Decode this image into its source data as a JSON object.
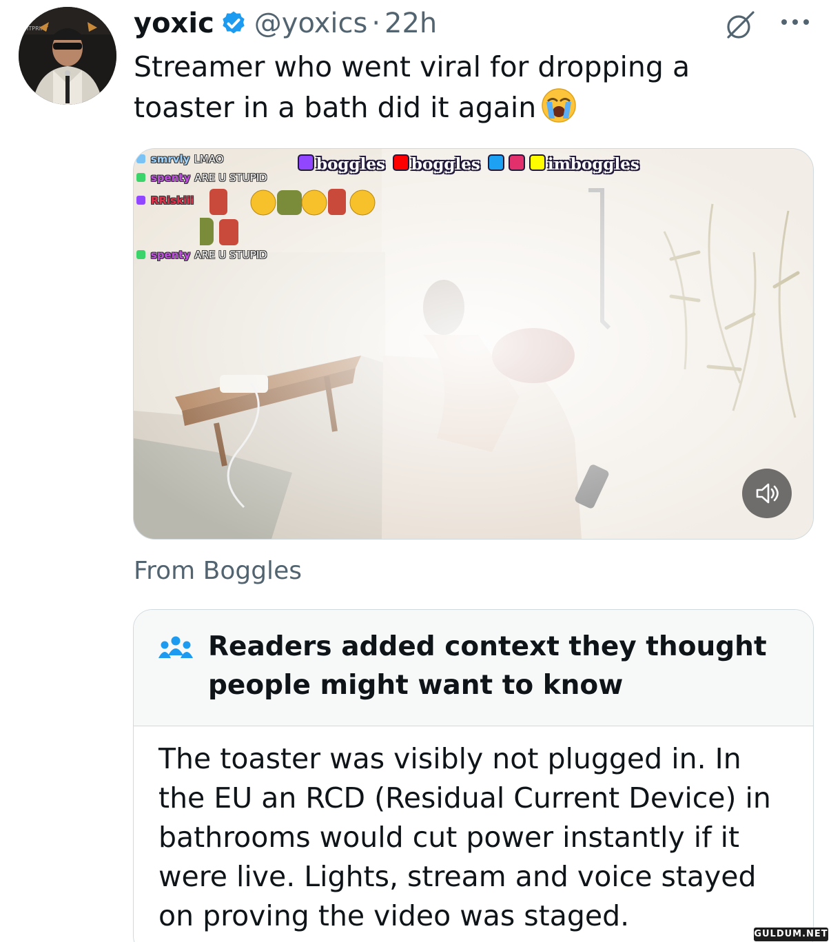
{
  "tweet": {
    "display_name": "yoxic",
    "handle": "@yoxics",
    "separator": "·",
    "time": "22h",
    "text": "Streamer who went viral for dropping a toaster in a bath did it again",
    "emoji": "loudly-crying-face",
    "verified": true
  },
  "media": {
    "handles_overlay": [
      "boggles",
      "boggles",
      "imboggles"
    ],
    "chat": [
      {
        "user": "smrvly",
        "message": "LMAO"
      },
      {
        "user": "spenty",
        "message": "ARE U STUPID"
      },
      {
        "user": "RRiskiii",
        "message": ""
      },
      {
        "user": "spenty",
        "message": "ARE U STUPID"
      }
    ],
    "mute_icon": "speaker-muted-icon"
  },
  "attribution": "From Boggles",
  "community_note": {
    "title": "Readers added context they thought people might want to know",
    "body": "The toaster was visibly not plugged in. In the EU an RCD (Residual Current Device) in bathrooms would cut power instantly if it were live. Lights, stream and voice stayed on proving the video was staged."
  },
  "watermark": "GULDUM.NET",
  "colors": {
    "verified_blue": "#1d9bf0",
    "secondary_text": "#536471",
    "note_header_bg": "#f7f9f9"
  }
}
